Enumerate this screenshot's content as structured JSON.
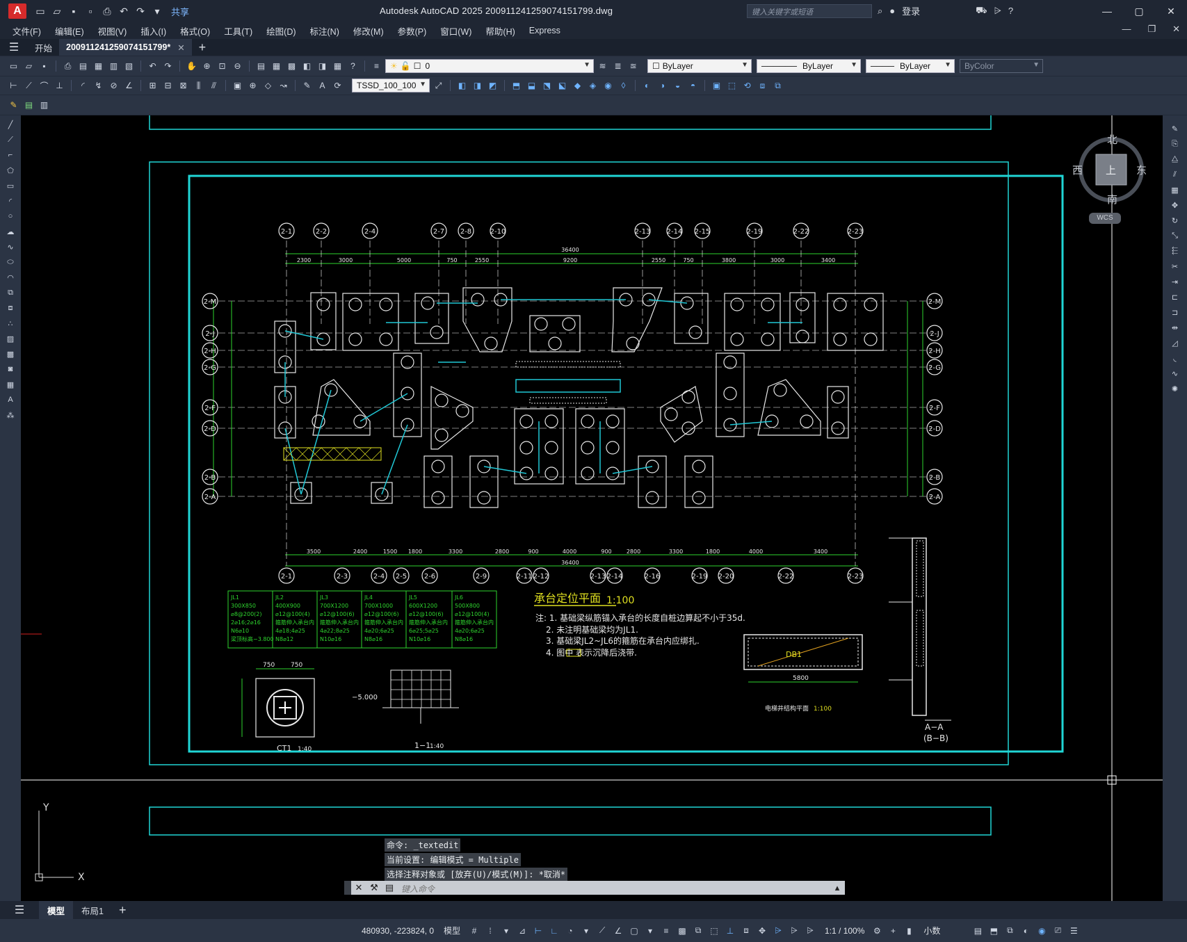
{
  "app": {
    "title": "Autodesk AutoCAD 2025    20091124125907415179​9.dwg",
    "title_clean": "Autodesk AutoCAD 2025    20091124125907415179​9.dwg",
    "share": "共享",
    "search_placeholder": "键入关键字或短语",
    "login": "登录"
  },
  "menu": [
    "文件(F)",
    "编辑(E)",
    "视图(V)",
    "插入(I)",
    "格式(O)",
    "工具(T)",
    "绘图(D)",
    "标注(N)",
    "修改(M)",
    "参数(P)",
    "窗口(W)",
    "帮助(H)",
    "Express"
  ],
  "tabs": [
    {
      "label": "开始"
    },
    {
      "label": "20091124125907415179​9*"
    }
  ],
  "toolbar": {
    "layer_value": "0",
    "color_value": "ByLayer",
    "linetype_value": "ByLayer",
    "lineweight_value": "ByLayer",
    "plotstyle_value": "ByColor",
    "textstyle_value": "TSSD_100_100"
  },
  "viewcube": {
    "north": "北",
    "south": "南",
    "east": "东",
    "west": "西",
    "top": "上",
    "wcs": "WCS"
  },
  "drawing": {
    "title": "承台定位平面",
    "scale": "1:100",
    "note_header": "注: 1. 基础梁纵筋锚入承台的长度自桩边算起不小于35d.",
    "note2": "2. 未注明基础梁均为JL1.",
    "note3": "3. 基础梁JL2~JL6的箍筋在承台内应绑扎.",
    "note4": "4. 图中 表示沉降后浇带.",
    "top_axes": [
      "2-1",
      "2-2",
      "2-4",
      "2-7",
      "2-8",
      "2-10",
      "2-13",
      "2-14",
      "2-15",
      "2-19",
      "2-22",
      "2-23"
    ],
    "bottom_axes": [
      "2-1",
      "2-3",
      "2-4",
      "2-5",
      "2-6",
      "2-9",
      "2-11",
      "2-12",
      "2-13",
      "2-14",
      "2-16",
      "2-19",
      "2-20",
      "2-22",
      "2-23"
    ],
    "row_axes": [
      "2-M",
      "2-J",
      "2-H",
      "2-G",
      "2-F",
      "2-D",
      "2-B",
      "2-A"
    ],
    "top_dims": [
      "2300",
      "3000",
      "5000",
      "750",
      "2550",
      "9200",
      "2550",
      "750",
      "3800",
      "3000",
      "3400"
    ],
    "bottom_dims": [
      "3500",
      "2400",
      "1500",
      "1800",
      "3300",
      "2800",
      "900",
      "4000",
      "900",
      "2800",
      "3300",
      "1800",
      "4000",
      "3400"
    ],
    "total_dim": "36400",
    "beam_table": [
      {
        "name": "JL1",
        "size": "300X850",
        "l1": "⌀8@200(2)",
        "l2": "2⌀16;2⌀16",
        "l3": "N6⌀10",
        "l4": "梁顶标高−3.800"
      },
      {
        "name": "JL2",
        "size": "400X900",
        "l1": "⌀12@100(4)",
        "l2": "箍筋伸入承台内",
        "l3": "4⌀18;4⌀25",
        "l4": "N8⌀12"
      },
      {
        "name": "JL3",
        "size": "700X1200",
        "l1": "⌀12@100(6)",
        "l2": "箍筋伸入承台内",
        "l3": "4⌀22;8⌀25",
        "l4": "N10⌀16"
      },
      {
        "name": "JL4",
        "size": "700X1000",
        "l1": "⌀12@100(6)",
        "l2": "箍筋伸入承台内",
        "l3": "4⌀20;6⌀25",
        "l4": "N8⌀16"
      },
      {
        "name": "JL5",
        "size": "600X1200",
        "l1": "⌀12@100(6)",
        "l2": "箍筋伸入承台内",
        "l3": "6⌀25;5⌀25",
        "l4": "N10⌀16"
      },
      {
        "name": "JL6",
        "size": "500X800",
        "l1": "⌀12@100(4)",
        "l2": "箍筋伸入承台内",
        "l3": "4⌀20;6⌀25",
        "l4": "N8⌀16"
      }
    ],
    "ct1_label": "CT1",
    "ct1_scale": "1:40",
    "sec11_label": "1−1",
    "sec11_scale": "1:40",
    "secAA_label": "A−A",
    "secBB_label": "(B−B)",
    "elev_label": "−5.000",
    "pit_label": "电梯井结构平面",
    "pit_scale": "1:100",
    "db1": "DB1",
    "dim_750": "750",
    "dim_5800": "5800"
  },
  "command": {
    "history": [
      "命令: _textedit",
      "当前设置: 编辑模式 = Multiple",
      "选择注释对象或 [放弃(U)/模式(M)]: *取消*"
    ],
    "placeholder": "键入命令"
  },
  "layouts": [
    {
      "label": "模型"
    },
    {
      "label": "布局1"
    }
  ],
  "status": {
    "coords": "480930, -223824, 0",
    "model": "模型",
    "scale": "1:1 / 100%",
    "units": "小数"
  }
}
